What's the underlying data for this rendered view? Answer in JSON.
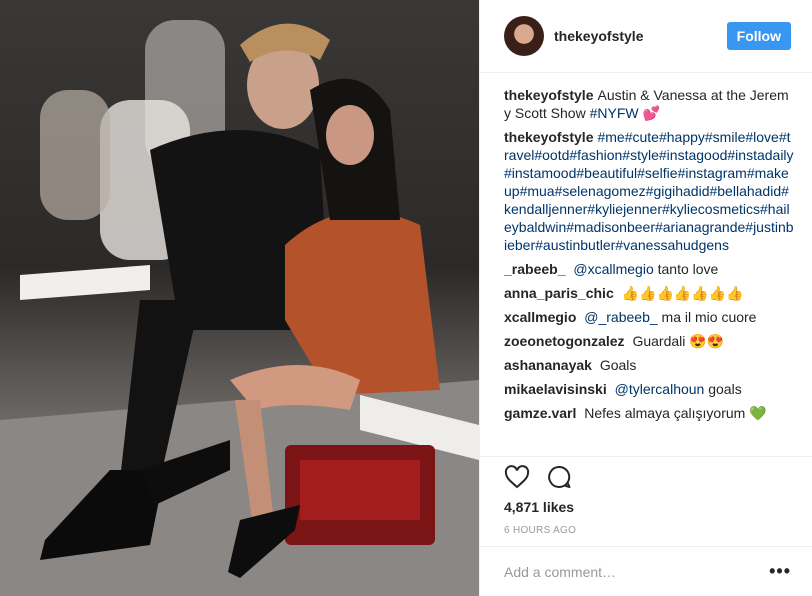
{
  "post": {
    "username": "thekeyofstyle",
    "follow_label": "Follow",
    "caption_text": "Austin & Vanessa at the Jeremy Scott Show",
    "caption_tag": "#NYFW",
    "caption_emoji": "💕",
    "hashtags_text": "#me#cute#happy#smile#love#travel#ootd#fashion#style#instagood#instadaily#instamood#beautiful#selfie#instagram#makeup#mua#selenagomez#gigihadid#bellahadid#kendalljenner#kyliejenner#kyliecosmetics#haileybaldwin#madisonbeer#arianagrande#justinbieber#austinbutler#vanessahudgens",
    "comments": [
      {
        "user": "_rabeeb_",
        "mention": "@xcallmegio",
        "text": "tanto love"
      },
      {
        "user": "anna_paris_chic",
        "mention": "",
        "text": "👍👍👍👍👍👍👍"
      },
      {
        "user": "xcallmegio",
        "mention": "@_rabeeb_",
        "text": "ma il mio cuore"
      },
      {
        "user": "zoeonetogonzalez",
        "mention": "",
        "text": "Guardali 😍😍"
      },
      {
        "user": "ashananayak",
        "mention": "",
        "text": "Goals"
      },
      {
        "user": "mikaelavisinski",
        "mention": "@tylercalhoun",
        "text": "goals"
      },
      {
        "user": "gamze.varl",
        "mention": "",
        "text": "Nefes almaya çalışıyorum 💚"
      }
    ],
    "likes": "4,871 likes",
    "time": "6 HOURS AGO",
    "comment_placeholder": "Add a comment…",
    "more_label": "•••"
  },
  "icons": {
    "like": "heart-icon",
    "comment": "comment-bubble-icon",
    "more": "more-options-icon"
  },
  "colors": {
    "follow_bg": "#3897f0",
    "link": "#003569",
    "muted": "#999999"
  }
}
